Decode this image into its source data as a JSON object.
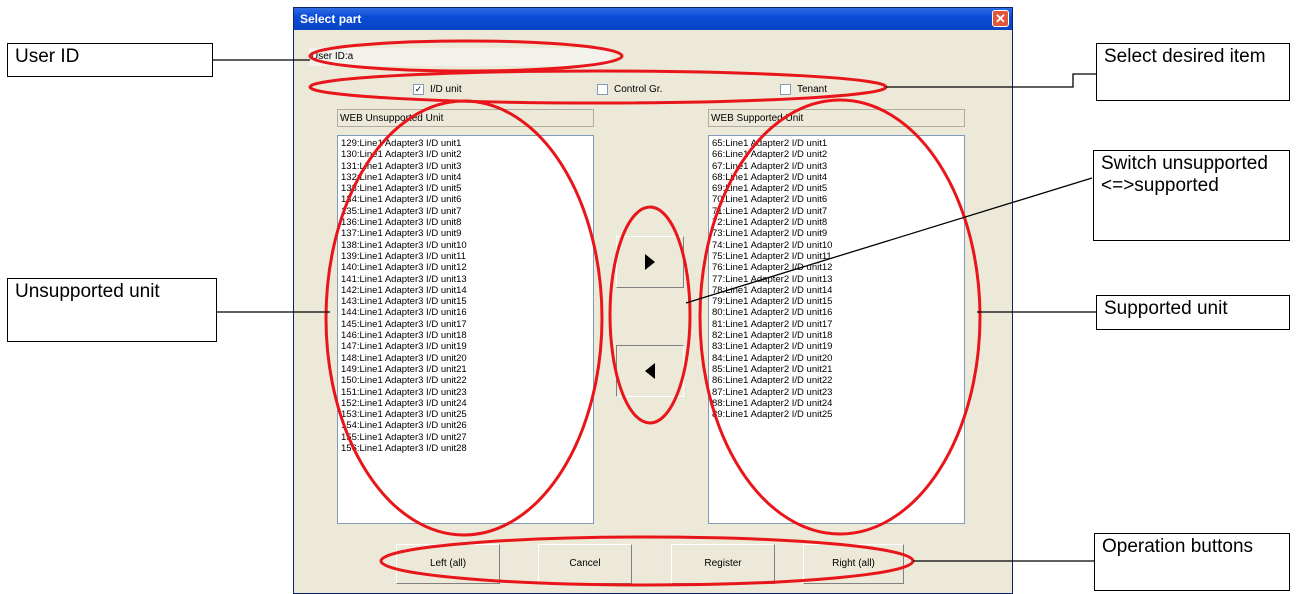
{
  "window": {
    "title": "Select part",
    "close_glyph": "✕"
  },
  "user_id": "User ID:a",
  "checkboxes": [
    {
      "label": "I/D unit",
      "checked": true
    },
    {
      "label": "Control Gr.",
      "checked": false
    },
    {
      "label": "Tenant",
      "checked": false
    }
  ],
  "unsupported": {
    "header": "WEB Unsupported Unit",
    "items": [
      "129:Line1 Adapter3 I/D unit1",
      "130:Line1 Adapter3 I/D unit2",
      "131:Line1 Adapter3 I/D unit3",
      "132:Line1 Adapter3 I/D unit4",
      "133:Line1 Adapter3 I/D unit5",
      "134:Line1 Adapter3 I/D unit6",
      "135:Line1 Adapter3 I/D unit7",
      "136:Line1 Adapter3 I/D unit8",
      "137:Line1 Adapter3 I/D unit9",
      "138:Line1 Adapter3 I/D unit10",
      "139:Line1 Adapter3 I/D unit11",
      "140:Line1 Adapter3 I/D unit12",
      "141:Line1 Adapter3 I/D unit13",
      "142:Line1 Adapter3 I/D unit14",
      "143:Line1 Adapter3 I/D unit15",
      "144:Line1 Adapter3 I/D unit16",
      "145:Line1 Adapter3 I/D unit17",
      "146:Line1 Adapter3 I/D unit18",
      "147:Line1 Adapter3 I/D unit19",
      "148:Line1 Adapter3 I/D unit20",
      "149:Line1 Adapter3 I/D unit21",
      "150:Line1 Adapter3 I/D unit22",
      "151:Line1 Adapter3 I/D unit23",
      "152:Line1 Adapter3 I/D unit24",
      "153:Line1 Adapter3 I/D unit25",
      "154:Line1 Adapter3 I/D unit26",
      "155:Line1 Adapter3 I/D unit27",
      "156:Line1 Adapter3 I/D unit28"
    ]
  },
  "supported": {
    "header": "WEB Supported Unit",
    "items": [
      "65:Line1 Adapter2 I/D unit1",
      "66:Line1 Adapter2 I/D unit2",
      "67:Line1 Adapter2 I/D unit3",
      "68:Line1 Adapter2 I/D unit4",
      "69:Line1 Adapter2 I/D unit5",
      "70:Line1 Adapter2 I/D unit6",
      "71:Line1 Adapter2 I/D unit7",
      "72:Line1 Adapter2 I/D unit8",
      "73:Line1 Adapter2 I/D unit9",
      "74:Line1 Adapter2 I/D unit10",
      "75:Line1 Adapter2 I/D unit11",
      "76:Line1 Adapter2 I/D unit12",
      "77:Line1 Adapter2 I/D unit13",
      "78:Line1 Adapter2 I/D unit14",
      "79:Line1 Adapter2 I/D unit15",
      "80:Line1 Adapter2 I/D unit16",
      "81:Line1 Adapter2 I/D unit17",
      "82:Line1 Adapter2 I/D unit18",
      "83:Line1 Adapter2 I/D unit19",
      "84:Line1 Adapter2 I/D unit20",
      "85:Line1 Adapter2 I/D unit21",
      "86:Line1 Adapter2 I/D unit22",
      "87:Line1 Adapter2 I/D unit23",
      "88:Line1 Adapter2 I/D unit24",
      "89:Line1 Adapter2 I/D unit25"
    ]
  },
  "arrows": {
    "right_icon": "triangle-right-icon",
    "left_icon": "triangle-left-icon"
  },
  "buttons": {
    "left_all": "Left (all)",
    "cancel": "Cancel",
    "register": "Register",
    "right_all": "Right (all)"
  },
  "callouts": {
    "user_id": "User ID",
    "select_item": "Select desired item",
    "switch": "Switch unsupported <=>supported",
    "unsupported": "Unsupported unit",
    "supported": "Supported unit",
    "operation": "Operation buttons"
  },
  "colors": {
    "annotation": "#e8161b",
    "title_bar": "#0a4bd7",
    "dialog_bg": "#ece9d8"
  }
}
